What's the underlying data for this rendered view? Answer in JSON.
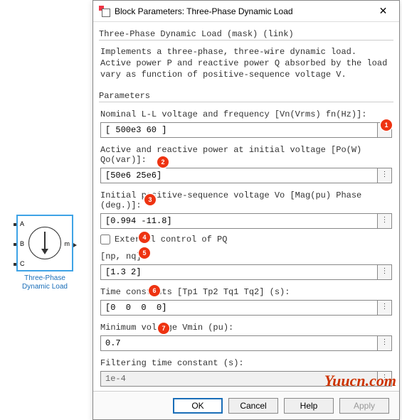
{
  "block": {
    "name_line1": "Three-Phase",
    "name_line2": "Dynamic Load",
    "port_a": "A",
    "port_b": "B",
    "port_c": "C",
    "port_m": "m"
  },
  "dialog": {
    "title": "Block Parameters: Three-Phase Dynamic Load",
    "mask_header": "Three-Phase Dynamic Load (mask) ",
    "mask_link": "(link)",
    "description": "Implements a three-phase, three-wire dynamic load. Active power P and reactive power Q absorbed by the load vary as function of positive-sequence voltage V.",
    "params_header": "Parameters"
  },
  "params": {
    "nominal": {
      "label": "Nominal L-L voltage and frequency  [Vn(Vrms) fn(Hz)]:",
      "value": "[ 500e3 60 ]"
    },
    "active": {
      "label": "Active and reactive power at initial voltage [Po(W) Qo(var)]:",
      "value": "[50e6 25e6]"
    },
    "initial": {
      "label": "Initial positive-sequence voltage Vo [Mag(pu) Phase (deg.)]:",
      "value": "[0.994 -11.8]"
    },
    "external": {
      "label": "External control of PQ",
      "checked": false
    },
    "npnq": {
      "label": "[np, nq]:",
      "value": "[1.3 2]"
    },
    "timeconst": {
      "label": "Time constants [Tp1 Tp2 Tq1 Tq2]  (s):",
      "value": "[0  0  0  0]"
    },
    "vmin": {
      "label": "Minimum voltage Vmin (pu):",
      "value": "0.7"
    },
    "filter": {
      "label": "Filtering time constant (s):",
      "value": "1e-4"
    }
  },
  "buttons": {
    "ok": "OK",
    "cancel": "Cancel",
    "help": "Help",
    "apply": "Apply"
  },
  "markers": {
    "m1": "1",
    "m2": "2",
    "m3": "3",
    "m4": "4",
    "m5": "5",
    "m6": "6",
    "m7": "7"
  },
  "watermark": "Yuucn.com",
  "glyphs": {
    "close": "✕",
    "vdots": "⋮"
  }
}
